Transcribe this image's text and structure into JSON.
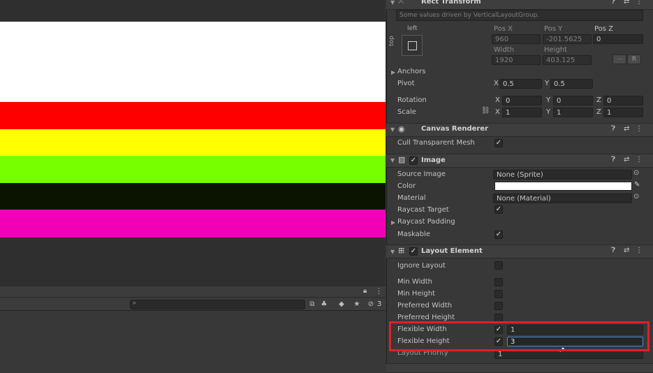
{
  "colors": {
    "stripes": [
      "#ffffff",
      "#ff0000",
      "#ffff00",
      "#77ff00",
      "#0b1400",
      "#f200b8"
    ],
    "highlight_box": "#e0202a"
  },
  "rect_transform": {
    "title": "Rect Transform",
    "info": "Some values driven by VerticalLayoutGroup.",
    "anchor_left": "left",
    "anchor_top": "top",
    "pos_x_label": "Pos X",
    "pos_y_label": "Pos Y",
    "pos_z_label": "Pos Z",
    "pos_x": "960",
    "pos_y": "-201.5625",
    "pos_z": "0",
    "width_label": "Width",
    "height_label": "Height",
    "width": "1920",
    "height": "403.125",
    "r_button": "R",
    "anchors_label": "Anchors",
    "pivot_label": "Pivot",
    "pivot_x": "0.5",
    "pivot_y": "0.5",
    "rotation_label": "Rotation",
    "rot_x": "0",
    "rot_y": "0",
    "rot_z": "0",
    "scale_label": "Scale",
    "scale_x": "1",
    "scale_y": "1",
    "scale_z": "1",
    "axis_x": "X",
    "axis_y": "Y",
    "axis_z": "Z"
  },
  "canvas_renderer": {
    "title": "Canvas Renderer",
    "cull_label": "Cull Transparent Mesh",
    "cull_checked": "✓"
  },
  "image": {
    "title": "Image",
    "enabled": "✓",
    "source_image_label": "Source Image",
    "source_image": "None (Sprite)",
    "color_label": "Color",
    "material_label": "Material",
    "material": "None (Material)",
    "raycast_target_label": "Raycast Target",
    "raycast_target": "✓",
    "raycast_padding_label": "Raycast Padding",
    "maskable_label": "Maskable",
    "maskable": "✓"
  },
  "layout_element": {
    "title": "Layout Element",
    "enabled": "✓",
    "ignore_layout_label": "Ignore Layout",
    "min_width_label": "Min Width",
    "min_height_label": "Min Height",
    "preferred_width_label": "Preferred Width",
    "preferred_height_label": "Preferred Height",
    "flexible_width_label": "Flexible Width",
    "flexible_width_check": "✓",
    "flexible_width": "1",
    "flexible_height_label": "Flexible Height",
    "flexible_height_check": "✓",
    "flexible_height": "3",
    "layout_priority_label": "Layout Priority",
    "layout_priority": "1"
  },
  "toolbar": {
    "hidden_count": "3"
  }
}
